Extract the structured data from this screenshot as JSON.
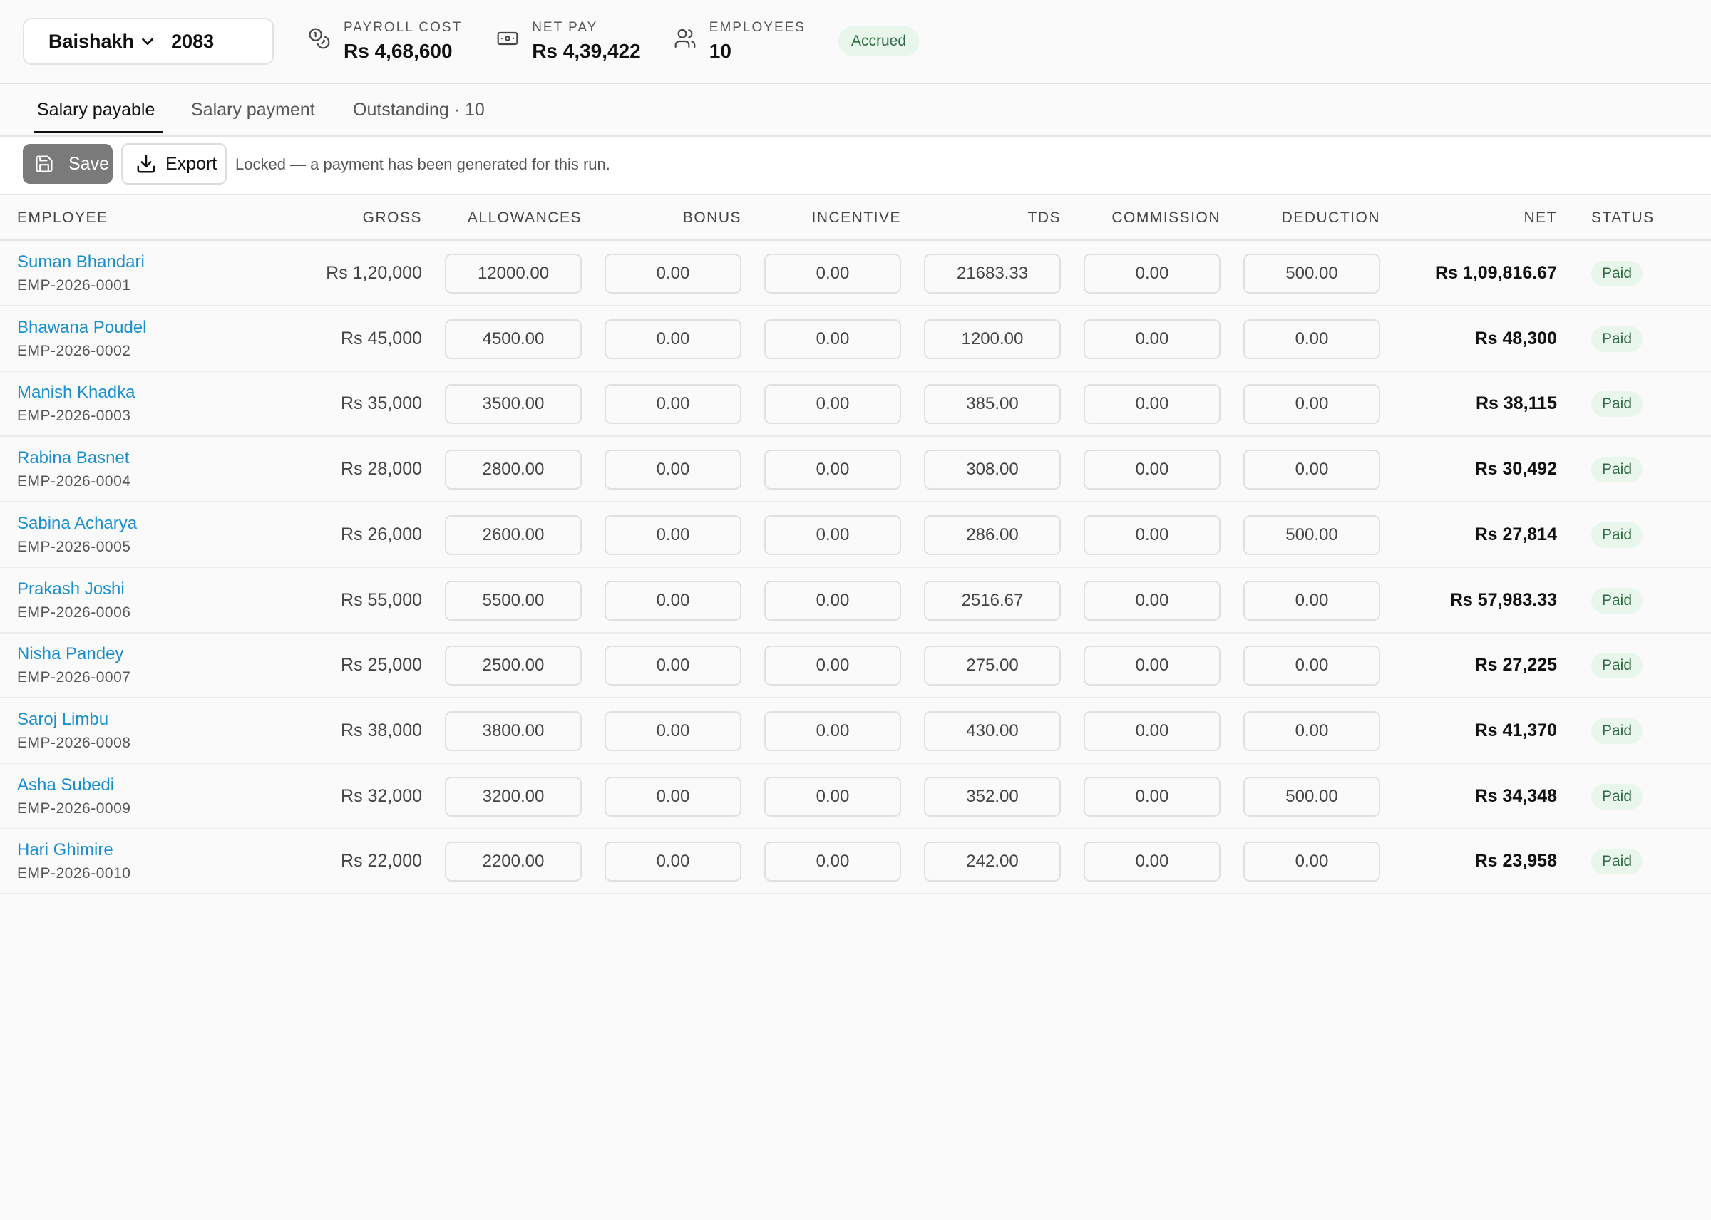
{
  "header": {
    "period": {
      "month": "Baishakh",
      "year": "2083"
    },
    "stats": [
      {
        "label": "PAYROLL COST",
        "value": "Rs 4,68,600",
        "icon": "coins-icon"
      },
      {
        "label": "NET PAY",
        "value": "Rs 4,39,422",
        "icon": "banknote-icon"
      },
      {
        "label": "EMPLOYEES",
        "value": "10",
        "icon": "users-icon"
      }
    ],
    "status_badge": "Accrued"
  },
  "tabs": [
    {
      "label": "Salary payable",
      "active": true
    },
    {
      "label": "Salary payment",
      "active": false
    },
    {
      "label": "Outstanding · 10",
      "active": false
    }
  ],
  "toolbar": {
    "save_label": "Save",
    "export_label": "Export",
    "lock_message": "Locked — a payment has been generated for this run."
  },
  "table": {
    "columns": [
      "EMPLOYEE",
      "GROSS",
      "ALLOWANCES",
      "BONUS",
      "INCENTIVE",
      "TDS",
      "COMMISSION",
      "DEDUCTION",
      "NET",
      "STATUS"
    ],
    "rows": [
      {
        "name": "Suman Bhandari",
        "id": "EMP-2026-0001",
        "gross": "Rs 1,20,000",
        "allowances": "12000.00",
        "bonus": "0.00",
        "incentive": "0.00",
        "tds": "21683.33",
        "commission": "0.00",
        "deduction": "500.00",
        "net": "Rs 1,09,816.67",
        "status": "Paid"
      },
      {
        "name": "Bhawana Poudel",
        "id": "EMP-2026-0002",
        "gross": "Rs 45,000",
        "allowances": "4500.00",
        "bonus": "0.00",
        "incentive": "0.00",
        "tds": "1200.00",
        "commission": "0.00",
        "deduction": "0.00",
        "net": "Rs 48,300",
        "status": "Paid"
      },
      {
        "name": "Manish Khadka",
        "id": "EMP-2026-0003",
        "gross": "Rs 35,000",
        "allowances": "3500.00",
        "bonus": "0.00",
        "incentive": "0.00",
        "tds": "385.00",
        "commission": "0.00",
        "deduction": "0.00",
        "net": "Rs 38,115",
        "status": "Paid"
      },
      {
        "name": "Rabina Basnet",
        "id": "EMP-2026-0004",
        "gross": "Rs 28,000",
        "allowances": "2800.00",
        "bonus": "0.00",
        "incentive": "0.00",
        "tds": "308.00",
        "commission": "0.00",
        "deduction": "0.00",
        "net": "Rs 30,492",
        "status": "Paid"
      },
      {
        "name": "Sabina Acharya",
        "id": "EMP-2026-0005",
        "gross": "Rs 26,000",
        "allowances": "2600.00",
        "bonus": "0.00",
        "incentive": "0.00",
        "tds": "286.00",
        "commission": "0.00",
        "deduction": "500.00",
        "net": "Rs 27,814",
        "status": "Paid"
      },
      {
        "name": "Prakash Joshi",
        "id": "EMP-2026-0006",
        "gross": "Rs 55,000",
        "allowances": "5500.00",
        "bonus": "0.00",
        "incentive": "0.00",
        "tds": "2516.67",
        "commission": "0.00",
        "deduction": "0.00",
        "net": "Rs 57,983.33",
        "status": "Paid"
      },
      {
        "name": "Nisha Pandey",
        "id": "EMP-2026-0007",
        "gross": "Rs 25,000",
        "allowances": "2500.00",
        "bonus": "0.00",
        "incentive": "0.00",
        "tds": "275.00",
        "commission": "0.00",
        "deduction": "0.00",
        "net": "Rs 27,225",
        "status": "Paid"
      },
      {
        "name": "Saroj Limbu",
        "id": "EMP-2026-0008",
        "gross": "Rs 38,000",
        "allowances": "3800.00",
        "bonus": "0.00",
        "incentive": "0.00",
        "tds": "430.00",
        "commission": "0.00",
        "deduction": "0.00",
        "net": "Rs 41,370",
        "status": "Paid"
      },
      {
        "name": "Asha Subedi",
        "id": "EMP-2026-0009",
        "gross": "Rs 32,000",
        "allowances": "3200.00",
        "bonus": "0.00",
        "incentive": "0.00",
        "tds": "352.00",
        "commission": "0.00",
        "deduction": "500.00",
        "net": "Rs 34,348",
        "status": "Paid"
      },
      {
        "name": "Hari Ghimire",
        "id": "EMP-2026-0010",
        "gross": "Rs 22,000",
        "allowances": "2200.00",
        "bonus": "0.00",
        "incentive": "0.00",
        "tds": "242.00",
        "commission": "0.00",
        "deduction": "0.00",
        "net": "Rs 23,958",
        "status": "Paid"
      }
    ]
  },
  "colors": {
    "link": "#1a8fd0",
    "badge_bg": "#e9f6ec",
    "badge_text": "#2f6b43",
    "save_bg": "#7a7a7a"
  }
}
